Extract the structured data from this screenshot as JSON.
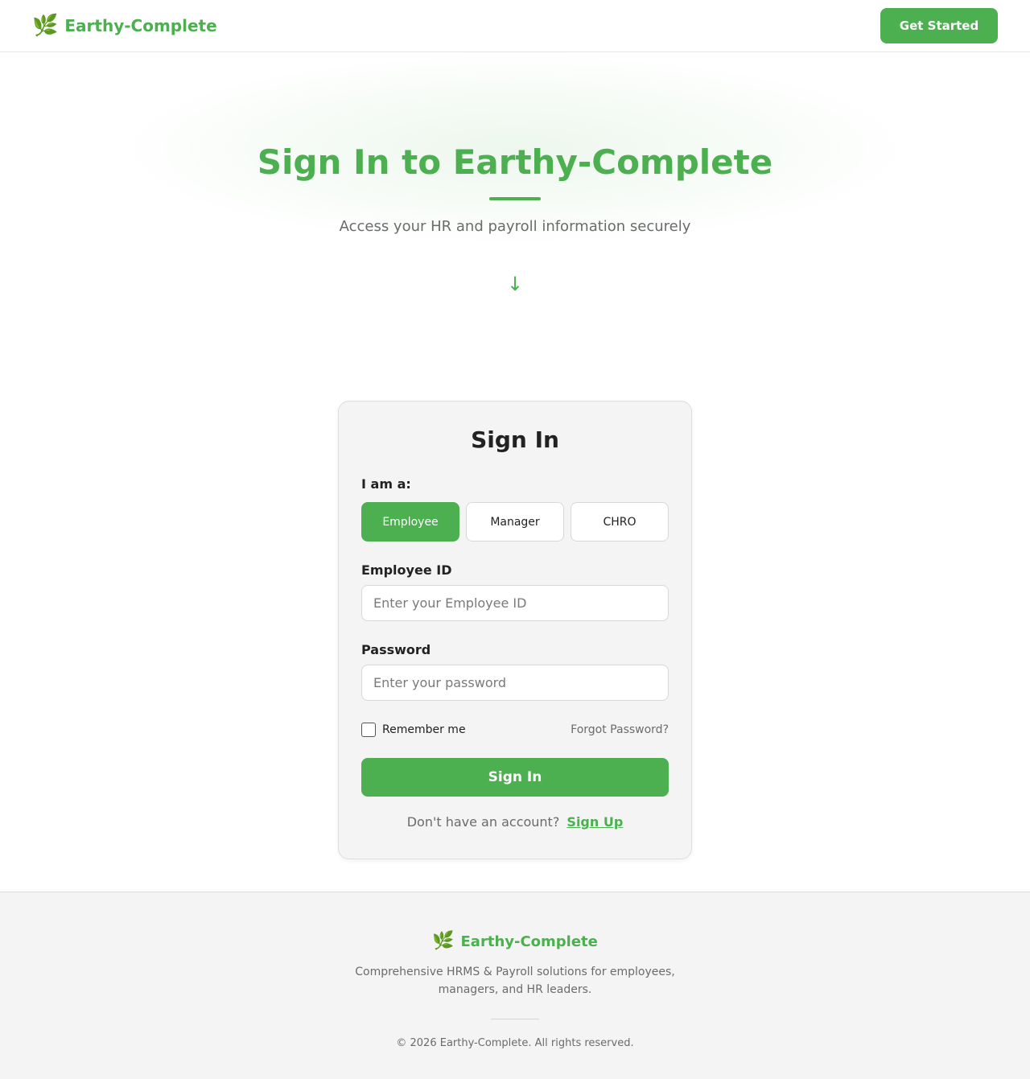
{
  "header": {
    "logo_icon": "leaf-icon",
    "logo_glyph": "🌿",
    "brand_name": "Earthy-Complete",
    "cta_label": "Get Started"
  },
  "hero": {
    "title": "Sign In to Earthy-Complete",
    "subtitle": "Access your HR and payroll information securely",
    "arrow_glyph": "↓",
    "arrow_icon": "arrow-down-icon"
  },
  "signin": {
    "title": "Sign In",
    "role_label": "I am a:",
    "roles": [
      "Employee",
      "Manager",
      "CHRO"
    ],
    "selected_role": "Employee",
    "id_label": "Employee ID",
    "id_placeholder": "Enter your Employee ID",
    "id_value": "",
    "password_label": "Password",
    "password_placeholder": "Enter your password",
    "password_value": "",
    "remember_label": "Remember me",
    "remember_checked": false,
    "forgot_label": "Forgot Password?",
    "submit_label": "Sign In",
    "no_account_text": "Don't have an account?",
    "signup_label": "Sign Up"
  },
  "footer": {
    "logo_glyph": "🌿",
    "brand_name": "Earthy-Complete",
    "description": "Comprehensive HRMS & Payroll solutions for employees, managers, and HR leaders.",
    "copyright": "© 2026 Earthy-Complete. All rights reserved."
  },
  "colors": {
    "accent": "#4caf50",
    "muted_text": "#6b6b6b",
    "card_bg": "#f4f4f4"
  }
}
